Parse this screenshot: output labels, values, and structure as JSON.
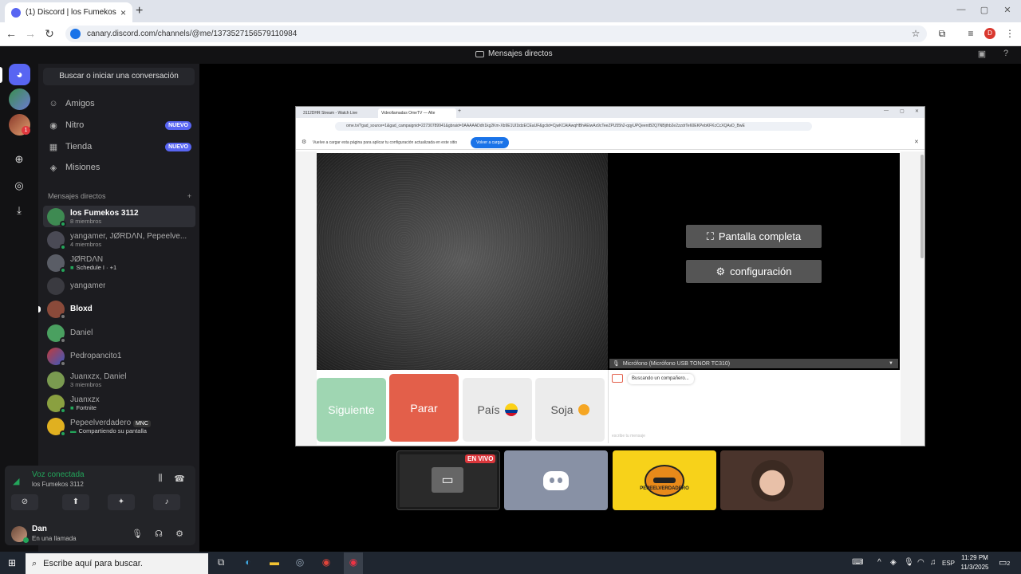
{
  "browser": {
    "tab_title": "(1) Discord | los Fumekos 3",
    "url": "canary.discord.com/channels/@me/1373527156579110984"
  },
  "discord": {
    "top_title": "Mensajes directos",
    "search_placeholder": "Buscar o iniciar una conversación",
    "nav": [
      {
        "label": "Amigos",
        "icon": "friends-icon"
      },
      {
        "label": "Nitro",
        "icon": "nitro-icon",
        "badge": "NUEVO"
      },
      {
        "label": "Tienda",
        "icon": "shop-icon",
        "badge": "NUEVO"
      },
      {
        "label": "Misiones",
        "icon": "quests-icon"
      }
    ],
    "dm_header": "Mensajes directos",
    "dms": [
      {
        "name": "los Fumekos 3112",
        "sub": "8 miembros"
      },
      {
        "name": "yangamer, JØRDΛN, Pepeelve...",
        "sub": "4 miembros"
      },
      {
        "name": "JØRDΛN",
        "sub": "Schedule I · +1"
      },
      {
        "name": "yangamer",
        "sub": ""
      },
      {
        "name": "Bloxd",
        "sub": ""
      },
      {
        "name": "Daniel",
        "sub": ""
      },
      {
        "name": "Pedropancito1",
        "sub": ""
      },
      {
        "name": "Juanxzx, Daniel",
        "sub": "3 miembros"
      },
      {
        "name": "Juanxzx",
        "sub": "Fortnite"
      },
      {
        "name": "Pepeelverdadero",
        "sub": "Compartiendo su pantalla",
        "tag": "MNC"
      }
    ],
    "voice": {
      "title": "Voz conectada",
      "channel": "los Fumekos 3112"
    },
    "user": {
      "name": "Dan",
      "status": "En una llamada"
    }
  },
  "shared_window": {
    "tab1": "3112DHR Stream - Watch Live",
    "tab2": "Videollamadas OmeTV — Alte",
    "url": "ome.tv/?gad_source=1&gad_campaignid=22730789941&gbraid=0AAAAADdh1kg2Km-Xb9E1Ul1tdzECEaUF&gclid=CjwKCAiAwqHBhAEiwAx9cTeeZPU55h2-qqyUPQeentB2Q7NBjthb2e2zzdrTe60EKPebKFKcCcXQAvD_BwE",
    "info_text": "Vuelve a cargar esta página para aplicar tu configuración actualizada en este sitio",
    "info_button": "Volver a cargar",
    "fullscreen": "Pantalla completa",
    "settings": "configuración",
    "mic": "Micrófono (Micrófono USB TONOR TC310)",
    "btn_next": "Siguiente",
    "btn_stop": "Parar",
    "btn_country": "País",
    "btn_gender": "Soja",
    "chat_status": "Buscando un compañero...",
    "chat_placeholder": "escribe tu mensaje"
  },
  "tiles": {
    "live": "EN VIVO",
    "brand": "PEPEELVERDADERO"
  },
  "taskbar": {
    "search": "Escribe aquí para buscar.",
    "lang": "ESP",
    "time": "11:29 PM",
    "date": "11/3/2025",
    "notif_count": "2"
  }
}
